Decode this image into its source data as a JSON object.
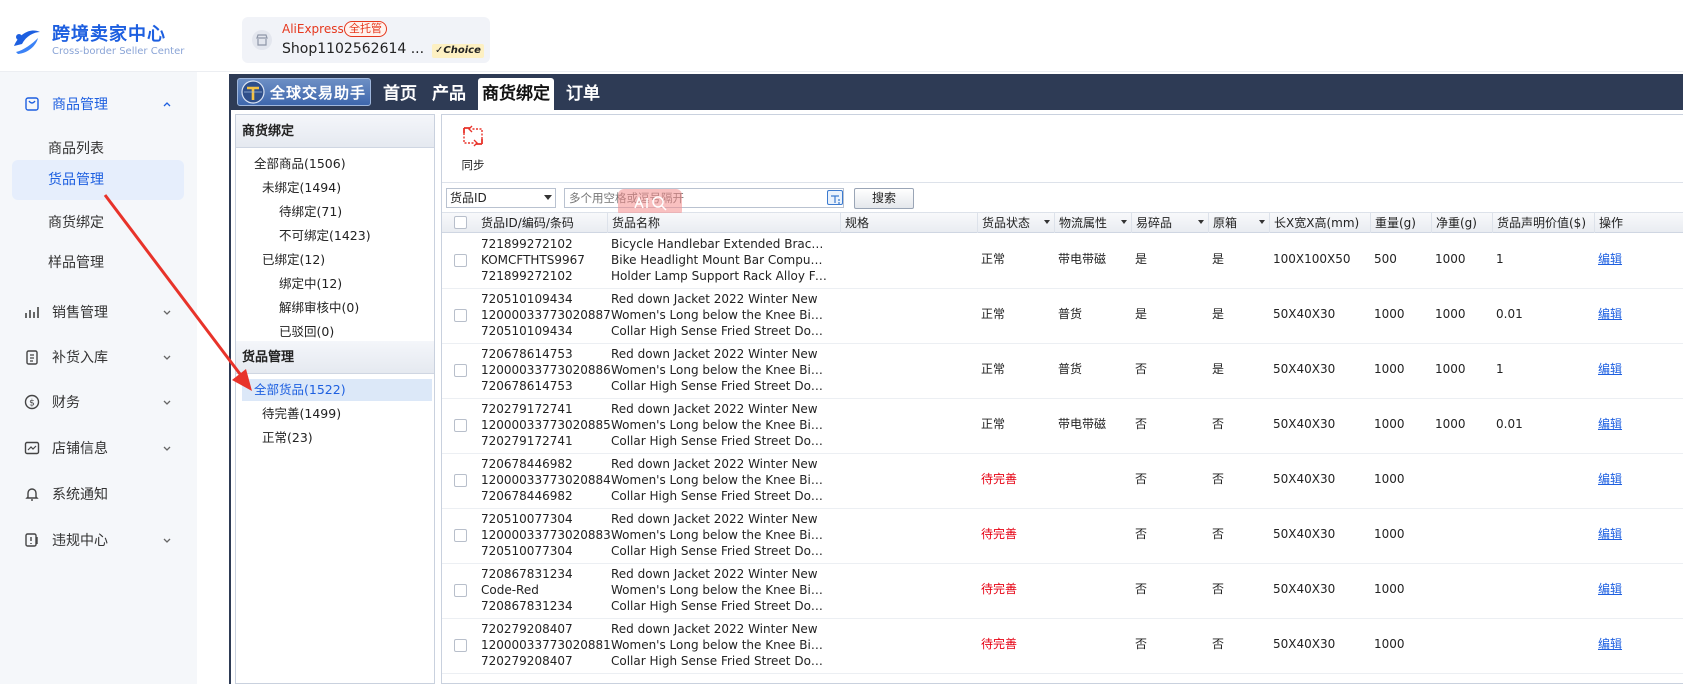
{
  "header": {
    "logo_zh": "跨境卖家中心",
    "logo_en": "Cross-border Seller Center",
    "store": {
      "platform": "AliExpress",
      "badge": "全托管",
      "name": "Shop1102562614 ...",
      "choice": "Choice"
    }
  },
  "sidebar": {
    "groups": [
      {
        "label": "商品管理",
        "icon": "bag-icon",
        "expanded": true
      },
      {
        "label": "销售管理",
        "icon": "bar-chart-icon"
      },
      {
        "label": "补货入库",
        "icon": "clipboard-icon"
      },
      {
        "label": "财务",
        "icon": "dollar-icon"
      },
      {
        "label": "店铺信息",
        "icon": "chart-window-icon"
      },
      {
        "label": "系统通知",
        "icon": "bell-icon"
      },
      {
        "label": "违规中心",
        "icon": "warning-doc-icon"
      }
    ],
    "subitems": [
      {
        "label": "商品列表"
      },
      {
        "label": "货品管理",
        "selected": true
      },
      {
        "label": "商货绑定"
      },
      {
        "label": "样品管理"
      }
    ]
  },
  "plugin": {
    "brand": "全球交易助手",
    "tabs": [
      "首页",
      "产品",
      "商货绑定",
      "订单"
    ],
    "active_tab": "商货绑定",
    "tree": {
      "section1_title": "商货绑定",
      "section1_items": [
        "全部商品(1506)",
        "未绑定(1494)",
        "待绑定(71)",
        "不可绑定(1423)",
        "已绑定(12)",
        "绑定中(12)",
        "解绑审核中(0)",
        "已驳回(0)"
      ],
      "section2_title": "货品管理",
      "section2_items": [
        "全部货品(1522)",
        "待完善(1499)",
        "正常(23)"
      ]
    },
    "toolbar": {
      "sync_label": "同步"
    },
    "filter": {
      "select_value": "货品ID",
      "placeholder": "多个用空格或逗号隔开",
      "search_label": "搜索"
    },
    "table": {
      "columns": [
        "货品ID/编码/条码",
        "货品名称",
        "规格",
        "货品状态",
        "物流属性",
        "易碎品",
        "原箱",
        "长X宽X高(mm)",
        "重量(g)",
        "净重(g)",
        "货品声明价值($)",
        "操作"
      ],
      "rows": [
        {
          "ids": [
            "721899272102",
            "KOMCFTHTS9967",
            "721899272102"
          ],
          "name": [
            "Bicycle Handlebar Extended Bracket",
            "Bike Headlight Mount Bar Computer",
            "Holder Lamp Support Rack Alloy Fib..."
          ],
          "spec": "",
          "status": "正常",
          "logistics": "带电带磁",
          "fragile": "是",
          "orig_box": "是",
          "dims": "100X100X50",
          "weight": "500",
          "net_weight": "1000",
          "value": "1",
          "action": "编辑"
        },
        {
          "ids": [
            "720510109434",
            "12000033773020887",
            "720510109434"
          ],
          "name": [
            "Red down Jacket 2022 Winter New",
            "Women's Long below the Knee Big Fur",
            "Collar High Sense Fried Street Dong..."
          ],
          "spec": "",
          "status": "正常",
          "logistics": "普货",
          "fragile": "是",
          "orig_box": "是",
          "dims": "50X40X30",
          "weight": "1000",
          "net_weight": "1000",
          "value": "0.01",
          "action": "编辑"
        },
        {
          "ids": [
            "720678614753",
            "12000033773020886",
            "720678614753"
          ],
          "name": [
            "Red down Jacket 2022 Winter New",
            "Women's Long below the Knee Big Fur",
            "Collar High Sense Fried Street Dong..."
          ],
          "spec": "",
          "status": "正常",
          "logistics": "普货",
          "fragile": "否",
          "orig_box": "是",
          "dims": "50X40X30",
          "weight": "1000",
          "net_weight": "1000",
          "value": "1",
          "action": "编辑"
        },
        {
          "ids": [
            "720279172741",
            "12000033773020885",
            "720279172741"
          ],
          "name": [
            "Red down Jacket 2022 Winter New",
            "Women's Long below the Knee Big Fur",
            "Collar High Sense Fried Street Dong..."
          ],
          "spec": "",
          "status": "正常",
          "logistics": "带电带磁",
          "fragile": "否",
          "orig_box": "否",
          "dims": "50X40X30",
          "weight": "1000",
          "net_weight": "1000",
          "value": "0.01",
          "action": "编辑"
        },
        {
          "ids": [
            "720678446982",
            "12000033773020884",
            "720678446982"
          ],
          "name": [
            "Red down Jacket 2022 Winter New",
            "Women's Long below the Knee Big Fur",
            "Collar High Sense Fried Street Dong..."
          ],
          "spec": "",
          "status": "待完善",
          "logistics": "",
          "fragile": "否",
          "orig_box": "否",
          "dims": "50X40X30",
          "weight": "1000",
          "net_weight": "",
          "value": "",
          "action": "编辑"
        },
        {
          "ids": [
            "720510077304",
            "12000033773020883",
            "720510077304"
          ],
          "name": [
            "Red down Jacket 2022 Winter New",
            "Women's Long below the Knee Big Fur",
            "Collar High Sense Fried Street Dong..."
          ],
          "spec": "",
          "status": "待完善",
          "logistics": "",
          "fragile": "否",
          "orig_box": "否",
          "dims": "50X40X30",
          "weight": "1000",
          "net_weight": "",
          "value": "",
          "action": "编辑"
        },
        {
          "ids": [
            "720867831234",
            "Code-Red",
            "720867831234"
          ],
          "name": [
            "Red down Jacket 2022 Winter New",
            "Women's Long below the Knee Big Fur",
            "Collar High Sense Fried Street Dong..."
          ],
          "spec": "",
          "status": "待完善",
          "logistics": "",
          "fragile": "否",
          "orig_box": "否",
          "dims": "50X40X30",
          "weight": "1000",
          "net_weight": "",
          "value": "",
          "action": "编辑"
        },
        {
          "ids": [
            "720279208407",
            "12000033773020881",
            "720279208407"
          ],
          "name": [
            "Red down Jacket 2022 Winter New",
            "Women's Long below the Knee Big Fur",
            "Collar High Sense Fried Street Dong..."
          ],
          "spec": "",
          "status": "待完善",
          "logistics": "",
          "fragile": "否",
          "orig_box": "否",
          "dims": "50X40X30",
          "weight": "1000",
          "net_weight": "",
          "value": "",
          "action": "编辑"
        }
      ]
    }
  },
  "colors": {
    "accent": "#1d5fe0",
    "nav_bg": "#2e3b55",
    "warn": "#e60012",
    "annotation": "#e8332a"
  }
}
